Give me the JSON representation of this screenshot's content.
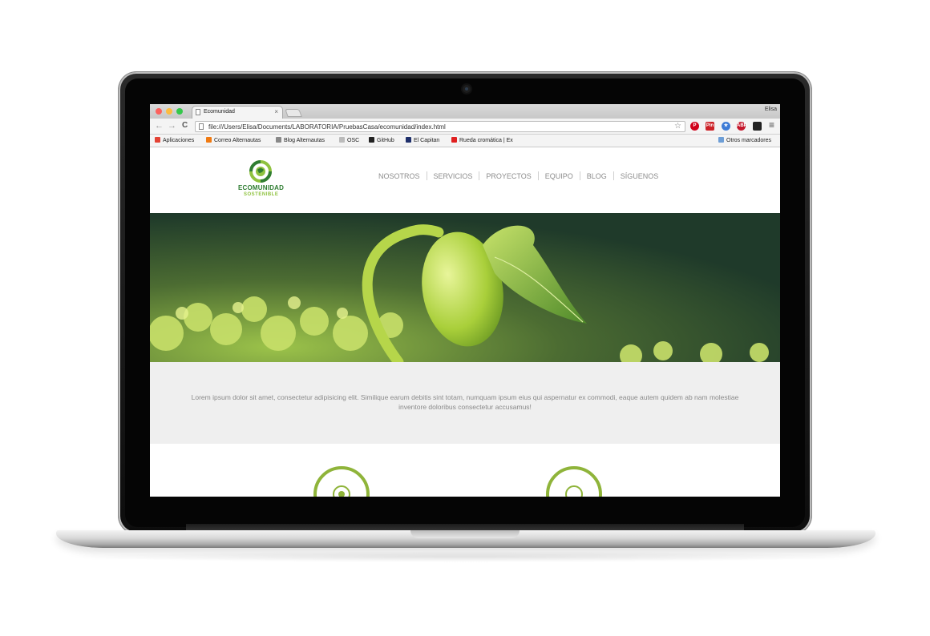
{
  "browser": {
    "tab_title": "Ecomunidad",
    "tab_close": "×",
    "profile_name": "Elisa",
    "back_icon": "←",
    "forward_icon": "→",
    "reload_icon": "C",
    "url": "file:///Users/Elisa/Documents/LABORATORIA/PruebasCasa/ecomunidad/index.html",
    "star_icon": "☆",
    "extensions": [
      {
        "name": "pinterest",
        "label": "P",
        "color": "#d0021b"
      },
      {
        "name": "pin",
        "label": "Pin",
        "color": "#cc2127"
      },
      {
        "name": "blue-star",
        "label": "★",
        "color": "#3d7bd6"
      },
      {
        "name": "adblock-plus",
        "label": "ABP",
        "color": "#c4162b"
      },
      {
        "name": "evernote",
        "label": "",
        "color": "#222222"
      }
    ],
    "menu_icon": "≡",
    "bookmarks": [
      {
        "label": "Aplicaciones",
        "color": "#e34234"
      },
      {
        "label": "Correo Alternautas",
        "color": "#f07a12"
      },
      {
        "label": "Blog Alternautas",
        "color": "#888888"
      },
      {
        "label": "OSC",
        "color": "#bbbbbb"
      },
      {
        "label": "GitHub",
        "color": "#222222"
      },
      {
        "label": "El Capitan",
        "color": "#1e2f6b"
      },
      {
        "label": "Rueda cromática | Ex",
        "color": "#e02020"
      }
    ],
    "other_bookmarks": "Otros marcadores"
  },
  "site": {
    "logo": {
      "line1": "ECOMUNIDAD",
      "line2": "SOSTENIBLE"
    },
    "nav": [
      "NOSOTROS",
      "SERVICIOS",
      "PROYECTOS",
      "EQUIPO",
      "BLOG",
      "SÍGUENOS"
    ],
    "intro": "Lorem ipsum dolor sit amet, consectetur adipisicing elit. Similique earum debitis sint totam, numquam ipsum eius qui aspernatur ex commodi, eaque autem quidem ab nam molestiae inventore doloribus consectetur accusamus!"
  },
  "colors": {
    "brand_dark_green": "#2f7d32",
    "brand_light_green": "#8fc23f",
    "intro_bg": "#efefef"
  }
}
